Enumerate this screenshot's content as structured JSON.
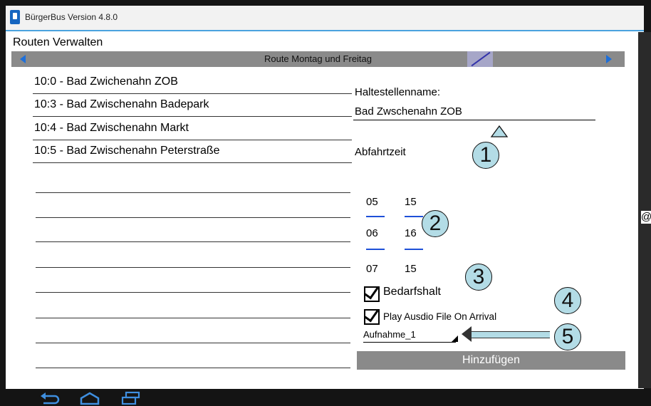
{
  "app": {
    "title": "BürgerBus Version 4.8.0"
  },
  "section_title": "Routen Verwalten",
  "route": {
    "title": "Route Montag und Freitag"
  },
  "stops": [
    {
      "label": "10:0  - Bad Zwichenahn ZOB"
    },
    {
      "label": "10:3  - Bad Zwischenahn Badepark"
    },
    {
      "label": "10:4  - Bad Zwischenahn Markt"
    },
    {
      "label": "10:5  - Bad Zwischenahn Peterstraße"
    }
  ],
  "form": {
    "stopname_label": "Haltestellenname:",
    "stopname_value": "Bad Zwschenahn  ZOB",
    "departure_label": "Abfahrtzeit",
    "time_rows": [
      {
        "hour": "05",
        "minute": "15"
      },
      {
        "hour": "06",
        "minute": "16"
      },
      {
        "hour": "07",
        "minute": "15"
      }
    ],
    "on_demand_label": "Bedarfshalt",
    "on_demand_checked": true,
    "play_audio_label": "Play Ausdio File On Arrival",
    "play_audio_checked": true,
    "audio_file_value": "Aufnahme_1",
    "add_button_label": "Hinzufügen"
  },
  "callouts": [
    "1",
    "2",
    "3",
    "4",
    "5"
  ],
  "colors": {
    "accent": "#1e6fd9",
    "callout_fill": "#b3dce6",
    "bar_gray": "#8a8a8a"
  },
  "edge_glyph": "@"
}
